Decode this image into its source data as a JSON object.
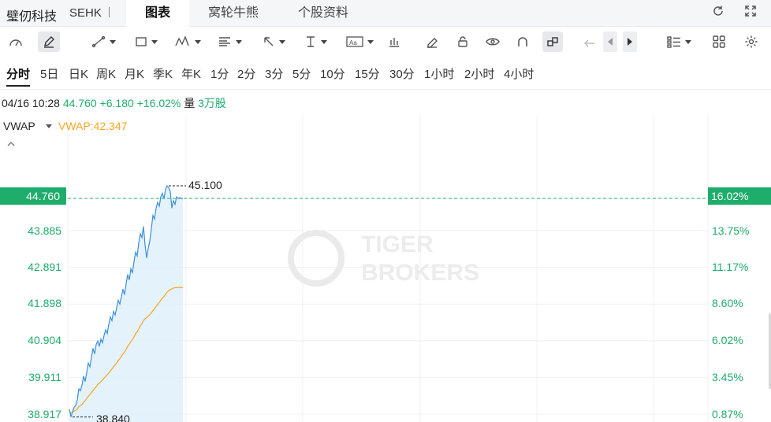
{
  "header": {
    "stock_name": "璧仞科技",
    "market": "SEHK",
    "tabs": [
      {
        "label": "图表",
        "active": true
      },
      {
        "label": "窝轮牛熊",
        "active": false
      },
      {
        "label": "个股资料",
        "active": false
      }
    ],
    "icons": [
      "refresh-icon",
      "fullscreen-icon"
    ]
  },
  "toolbar": {
    "tools": [
      "speedometer-icon",
      "pencil-edit-icon",
      "trend-line-icon",
      "rectangle-icon",
      "wave-pattern-icon",
      "fibonacci-icon",
      "arrow-icon",
      "text-cursor-icon",
      "text-note-icon",
      "bars-icon",
      "eraser-icon",
      "lock-icon",
      "eye-icon",
      "magnet-icon",
      "link-icon",
      "undo-icon",
      "prev-icon",
      "next-icon",
      "layout-list-icon",
      "grid-icon",
      "settings-icon"
    ]
  },
  "periods": [
    "分时",
    "5日",
    "日K",
    "周K",
    "月K",
    "季K",
    "年K",
    "1分",
    "2分",
    "3分",
    "5分",
    "10分",
    "15分",
    "30分",
    "1小时",
    "2小时",
    "4小时"
  ],
  "active_period": "分时",
  "info": {
    "datetime": "04/16 10:28",
    "price": "44.760",
    "change": "+6.180",
    "change_pct": "+16.02%",
    "volume_label": "量",
    "volume": "3万股"
  },
  "indicator": {
    "name": "VWAP",
    "value_text": "VWAP:42.347"
  },
  "axis": {
    "left_labels": [
      "43.885",
      "42.891",
      "41.898",
      "40.904",
      "39.911",
      "38.917"
    ],
    "right_labels": [
      "13.75%",
      "11.17%",
      "8.60%",
      "6.02%",
      "3.45%",
      "0.87%"
    ],
    "current_price_tag": "44.760",
    "current_pct_tag": "16.02%"
  },
  "annotations": {
    "high": "45.100",
    "low": "38.840"
  },
  "watermark": {
    "line1": "TIGER",
    "line2": "BROKERS"
  },
  "colors": {
    "up": "#1fad6b",
    "price_line": "#3b8fd9",
    "vwap_line": "#f5a623",
    "area_fill": "#dff0fb"
  },
  "chart_data": {
    "type": "line",
    "title": "",
    "xlabel": "",
    "ylabel": "",
    "ylim": [
      38.72,
      45.22
    ],
    "x": [
      0,
      2,
      4,
      6,
      8,
      10,
      12,
      14,
      16,
      18,
      20,
      22,
      24,
      26,
      28,
      30,
      32,
      34,
      36,
      38,
      40,
      42,
      44,
      46,
      48,
      50,
      52,
      54,
      56,
      58,
      60,
      62,
      64,
      66,
      68,
      70,
      72,
      74,
      76,
      78,
      80,
      82,
      84,
      86,
      88,
      90,
      92,
      94,
      96,
      98,
      100,
      102,
      104,
      106,
      108,
      110,
      112,
      114,
      116,
      118,
      120,
      122,
      124,
      126,
      128,
      130,
      132,
      134,
      136,
      138,
      140,
      142,
      144
    ],
    "series": [
      {
        "values": [
          39.05,
          38.84,
          38.98,
          39.1,
          39.15,
          39.3,
          39.6,
          39.55,
          39.7,
          39.95,
          39.8,
          40.05,
          40.3,
          40.2,
          40.45,
          40.7,
          40.55,
          40.8,
          40.9,
          40.75,
          40.95,
          40.85,
          41.05,
          41.2,
          41.1,
          41.35,
          41.55,
          41.45,
          41.7,
          41.6,
          41.8,
          42.0,
          41.9,
          42.1,
          42.3,
          42.15,
          42.45,
          42.7,
          42.55,
          42.85,
          42.75,
          43.05,
          43.3,
          43.2,
          43.55,
          43.8,
          43.7,
          44.0,
          43.5,
          43.15,
          43.4,
          43.6,
          43.95,
          44.3,
          44.2,
          44.5,
          44.65,
          44.55,
          44.8,
          44.9,
          44.75,
          45.0,
          45.1,
          45.05,
          44.95,
          44.5,
          44.7,
          44.6,
          44.8,
          44.76,
          44.78,
          44.76,
          44.76
        ]
      },
      {
        "values": [
          39.0,
          38.95,
          38.97,
          39.0,
          39.02,
          39.06,
          39.12,
          39.15,
          39.18,
          39.24,
          39.28,
          39.34,
          39.4,
          39.45,
          39.5,
          39.56,
          39.61,
          39.66,
          39.72,
          39.76,
          39.8,
          39.84,
          39.89,
          39.94,
          39.98,
          40.03,
          40.09,
          40.14,
          40.2,
          40.25,
          40.3,
          40.37,
          40.42,
          40.48,
          40.55,
          40.6,
          40.67,
          40.75,
          40.81,
          40.88,
          40.94,
          41.01,
          41.09,
          41.15,
          41.23,
          41.31,
          41.37,
          41.45,
          41.5,
          41.53,
          41.57,
          41.61,
          41.66,
          41.72,
          41.77,
          41.83,
          41.89,
          41.94,
          42.0,
          42.06,
          42.1,
          42.16,
          42.22,
          42.26,
          42.29,
          42.31,
          42.33,
          42.34,
          42.345,
          42.347,
          42.347,
          42.347,
          42.347
        ]
      }
    ],
    "y_ticks_left": [
      43.885,
      42.891,
      41.898,
      40.904,
      39.911,
      38.917
    ],
    "y_ticks_right_pct": [
      13.75,
      11.17,
      8.6,
      6.02,
      3.45,
      0.87
    ],
    "current_price": 44.76,
    "grid": true
  }
}
